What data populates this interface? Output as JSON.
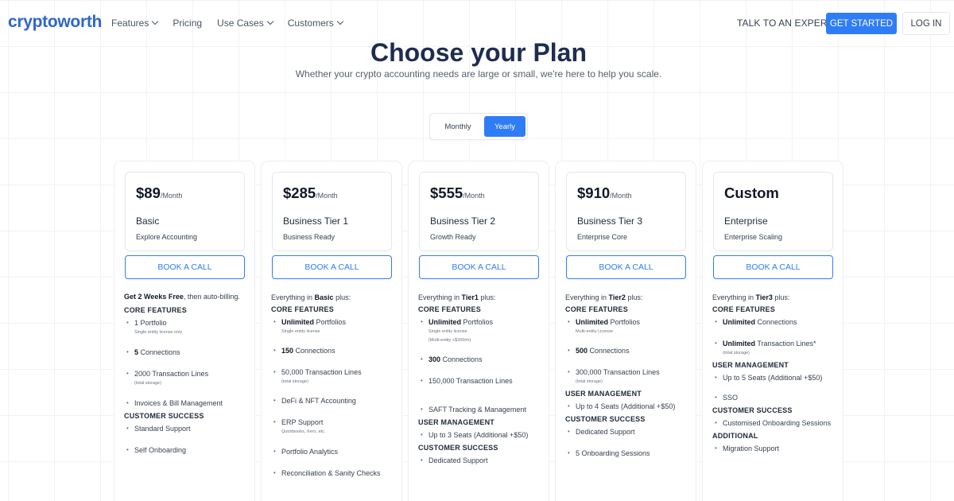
{
  "nav": {
    "logo": "cryptoworth",
    "menu": [
      {
        "label": "Features",
        "dropdown": true
      },
      {
        "label": "Pricing",
        "dropdown": false
      },
      {
        "label": "Use Cases",
        "dropdown": true
      },
      {
        "label": "Customers",
        "dropdown": true
      }
    ],
    "talk": "TALK TO AN EXPERT",
    "get_started": "GET STARTED",
    "login": "LOG IN"
  },
  "hero": {
    "title": "Choose your Plan",
    "subtitle": "Whether your crypto accounting needs are large or small, we're here to help you scale."
  },
  "toggle": {
    "monthly": "Monthly",
    "yearly": "Yearly",
    "selected": "Yearly"
  },
  "colors": {
    "brand": "#2f66c8",
    "accent": "#2f7df6",
    "heading": "#1e2d4f"
  },
  "plans": [
    {
      "price": "$89",
      "per": "/Month",
      "name": "Basic",
      "desc": "Explore Accounting",
      "cta": "BOOK A CALL",
      "lead_bold": "Get 2 Weeks Free",
      "lead_rest": ", then auto-billing.",
      "s1": "CORE FEATURES",
      "f1_text": "1 Portfolio",
      "f1_note": "Single entity license only",
      "f2_bold": "5",
      "f2_text": " Connections",
      "f3_text": "2000 Transaction Lines",
      "f3_note": "(total storage)",
      "f4_text": "Invoices & Bill Management",
      "s2": "CUSTOMER SUCCESS",
      "f5_text": "Standard Support",
      "f6_text": "Self Onboarding"
    },
    {
      "price": "$285",
      "per": "/Month",
      "name": "Business Tier 1",
      "desc": "Business Ready",
      "cta": "BOOK A CALL",
      "lead_pre": "Everything in ",
      "lead_bold": "Basic",
      "lead_post": " plus:",
      "s1": "CORE FEATURES",
      "f1_bold": "Unlimited",
      "f1_text": " Portfolios",
      "f1_note": "Single entity license",
      "f2_bold": "150",
      "f2_text": " Connections",
      "f3_text": "50,000 Transaction Lines",
      "f3_note": "(total storage)",
      "f4_text": "DeFi & NFT Accounting",
      "f5_text": "ERP Support",
      "f5_note": "Quickbooks, Xero, etc.",
      "f6_text": "Portfolio Analytics",
      "f7_text": "Reconciliation & Sanity Checks"
    },
    {
      "price": "$555",
      "per": "/Month",
      "name": "Business Tier 2",
      "desc": "Growth Ready",
      "cta": "BOOK A CALL",
      "lead_pre": "Everything in ",
      "lead_bold": "Tier1",
      "lead_post": " plus:",
      "s1": "CORE FEATURES",
      "f1_bold": "Unlimited",
      "f1_text": " Portfolios",
      "f1_note": "Single entity license",
      "f1_note2": "(Multi-entity +$200/m)",
      "f2_bold": "300",
      "f2_text": " Connections",
      "f3_text": "150,000 Transaction Lines",
      "f4_text": "SAFT Tracking & Management",
      "s2": "USER MANAGEMENT",
      "f5_text": "Up to 3 Seats (Additional +$50)",
      "s3": "CUSTOMER SUCCESS",
      "f6_text": "Dedicated Support"
    },
    {
      "price": "$910",
      "per": "/Month",
      "name": "Business Tier 3",
      "desc": "Enterprise Core",
      "cta": "BOOK A CALL",
      "lead_pre": "Everything in ",
      "lead_bold": "Tier2",
      "lead_post": " plus:",
      "s1": "CORE FEATURES",
      "f1_bold": "Unlimited",
      "f1_text": " Portfolios",
      "f1_note": "Multi-entity License",
      "f2_bold": "500",
      "f2_text": " Connections",
      "f3_text": "300,000 Transaction Lines",
      "f3_note": "(total storage)",
      "s2": "USER MANAGEMENT",
      "f4_text": "Up to 4 Seats (Additional +$50)",
      "s3": "CUSTOMER SUCCESS",
      "f5_text": "Dedicated Support",
      "f6_text": "5 Onboarding Sessions"
    },
    {
      "price": "Custom",
      "name": "Enterprise",
      "desc": "Enterprise Scaling",
      "cta": "BOOK A CALL",
      "lead_pre": "Everything in ",
      "lead_bold": "Tier3",
      "lead_post": " plus:",
      "s1": "CORE FEATURES",
      "f1_bold": "Unlimited",
      "f1_text": " Connections",
      "f2_bold": "Unlimited",
      "f2_text": " Transaction Lines*",
      "f2_note": "(total storage)",
      "s2": "USER MANAGEMENT",
      "f3_text": "Up to 5 Seats (Additional +$50)",
      "f4_text": "SSO",
      "s3": "CUSTOMER SUCCESS",
      "f5_text": "Customised Onboarding Sessions",
      "s4": "ADDITIONAL",
      "f6_text": "Migration Support"
    }
  ]
}
